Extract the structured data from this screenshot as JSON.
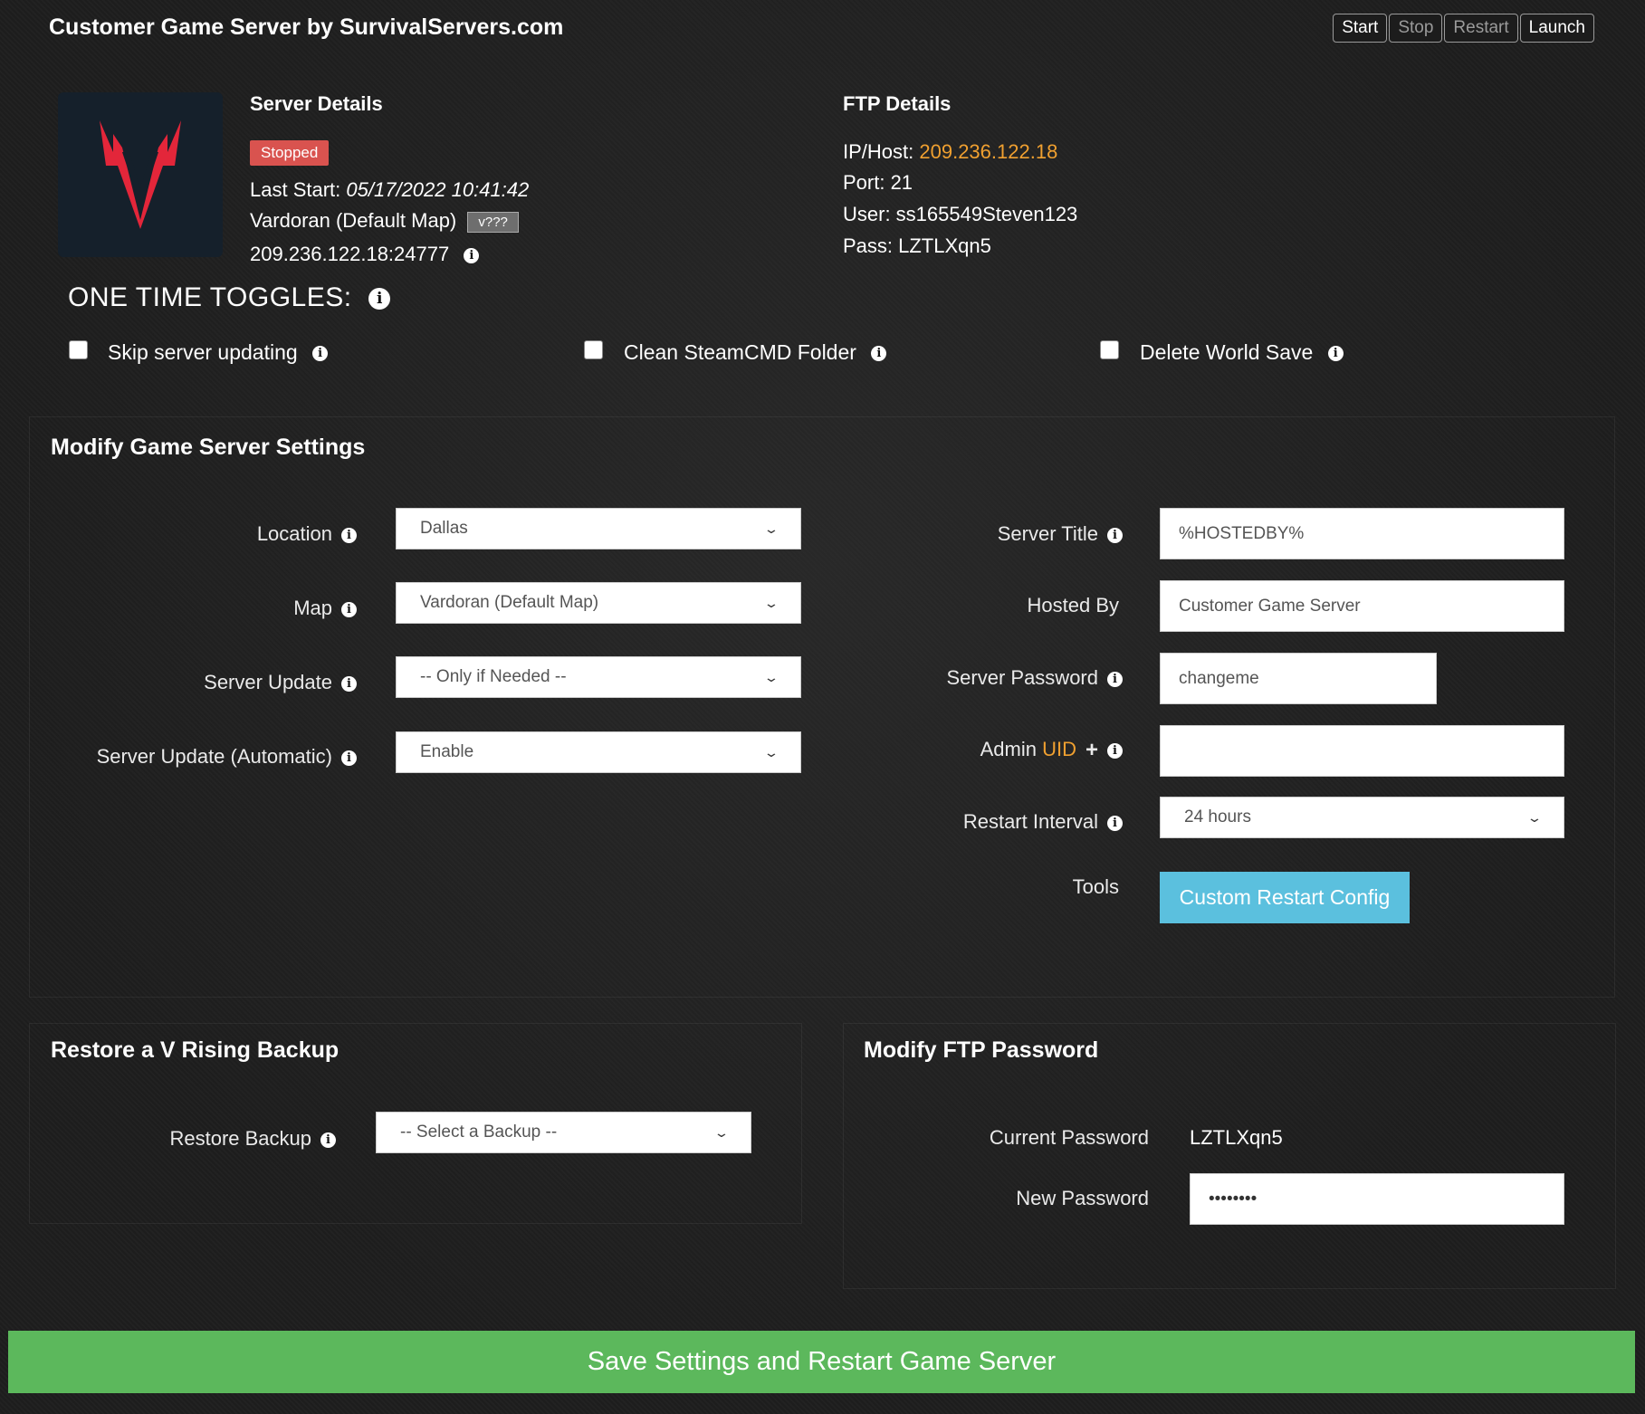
{
  "header": {
    "title": "Customer Game Server by SurvivalServers.com",
    "buttons": [
      "Start",
      "Stop",
      "Restart",
      "Launch"
    ]
  },
  "server_details": {
    "heading": "Server Details",
    "status": "Stopped",
    "status_color": "#d9534f",
    "last_start_label": "Last Start:",
    "last_start_value": "05/17/2022 10:41:42",
    "map": "Vardoran (Default Map)",
    "version": "v???",
    "address": "209.236.122.18:24777"
  },
  "ftp_details": {
    "heading": "FTP Details",
    "ip_label": "IP/Host:",
    "ip_value": "209.236.122.18",
    "port": "Port: 21",
    "user": "User: ss165549Steven123",
    "pass": "Pass: LZTLXqn5"
  },
  "toggles": {
    "heading": "ONE TIME TOGGLES:",
    "items": [
      "Skip server updating",
      "Clean SteamCMD Folder",
      "Delete World Save"
    ]
  },
  "settings": {
    "heading": "Modify Game Server Settings",
    "location_label": "Location",
    "location_value": "Dallas",
    "map_label": "Map",
    "map_value": "Vardoran (Default Map)",
    "update_label": "Server Update",
    "update_value": "-- Only if Needed --",
    "auto_update_label": "Server Update (Automatic)",
    "auto_update_value": "Enable",
    "title_label": "Server Title",
    "title_value": "%HOSTEDBY%",
    "hosted_label": "Hosted By",
    "hosted_value": "Customer Game Server",
    "password_label": "Server Password",
    "password_value": "changeme",
    "admin_label": "Admin",
    "admin_uid": "UID",
    "admin_value": "",
    "restart_label": "Restart Interval",
    "restart_value": "24 hours",
    "tools_label": "Tools",
    "tools_button": "Custom Restart Config"
  },
  "backup": {
    "heading": "Restore a V Rising Backup",
    "label": "Restore Backup",
    "value": "-- Select a Backup --"
  },
  "ftp_password": {
    "heading": "Modify FTP Password",
    "current_label": "Current Password",
    "current_value": "LZTLXqn5",
    "new_label": "New Password",
    "new_value": "••••••••"
  },
  "save_button": "Save Settings and Restart Game Server",
  "colors": {
    "accent_orange": "#f0a030",
    "blue_button": "#5bc0de",
    "green_button": "#5cb85c"
  }
}
